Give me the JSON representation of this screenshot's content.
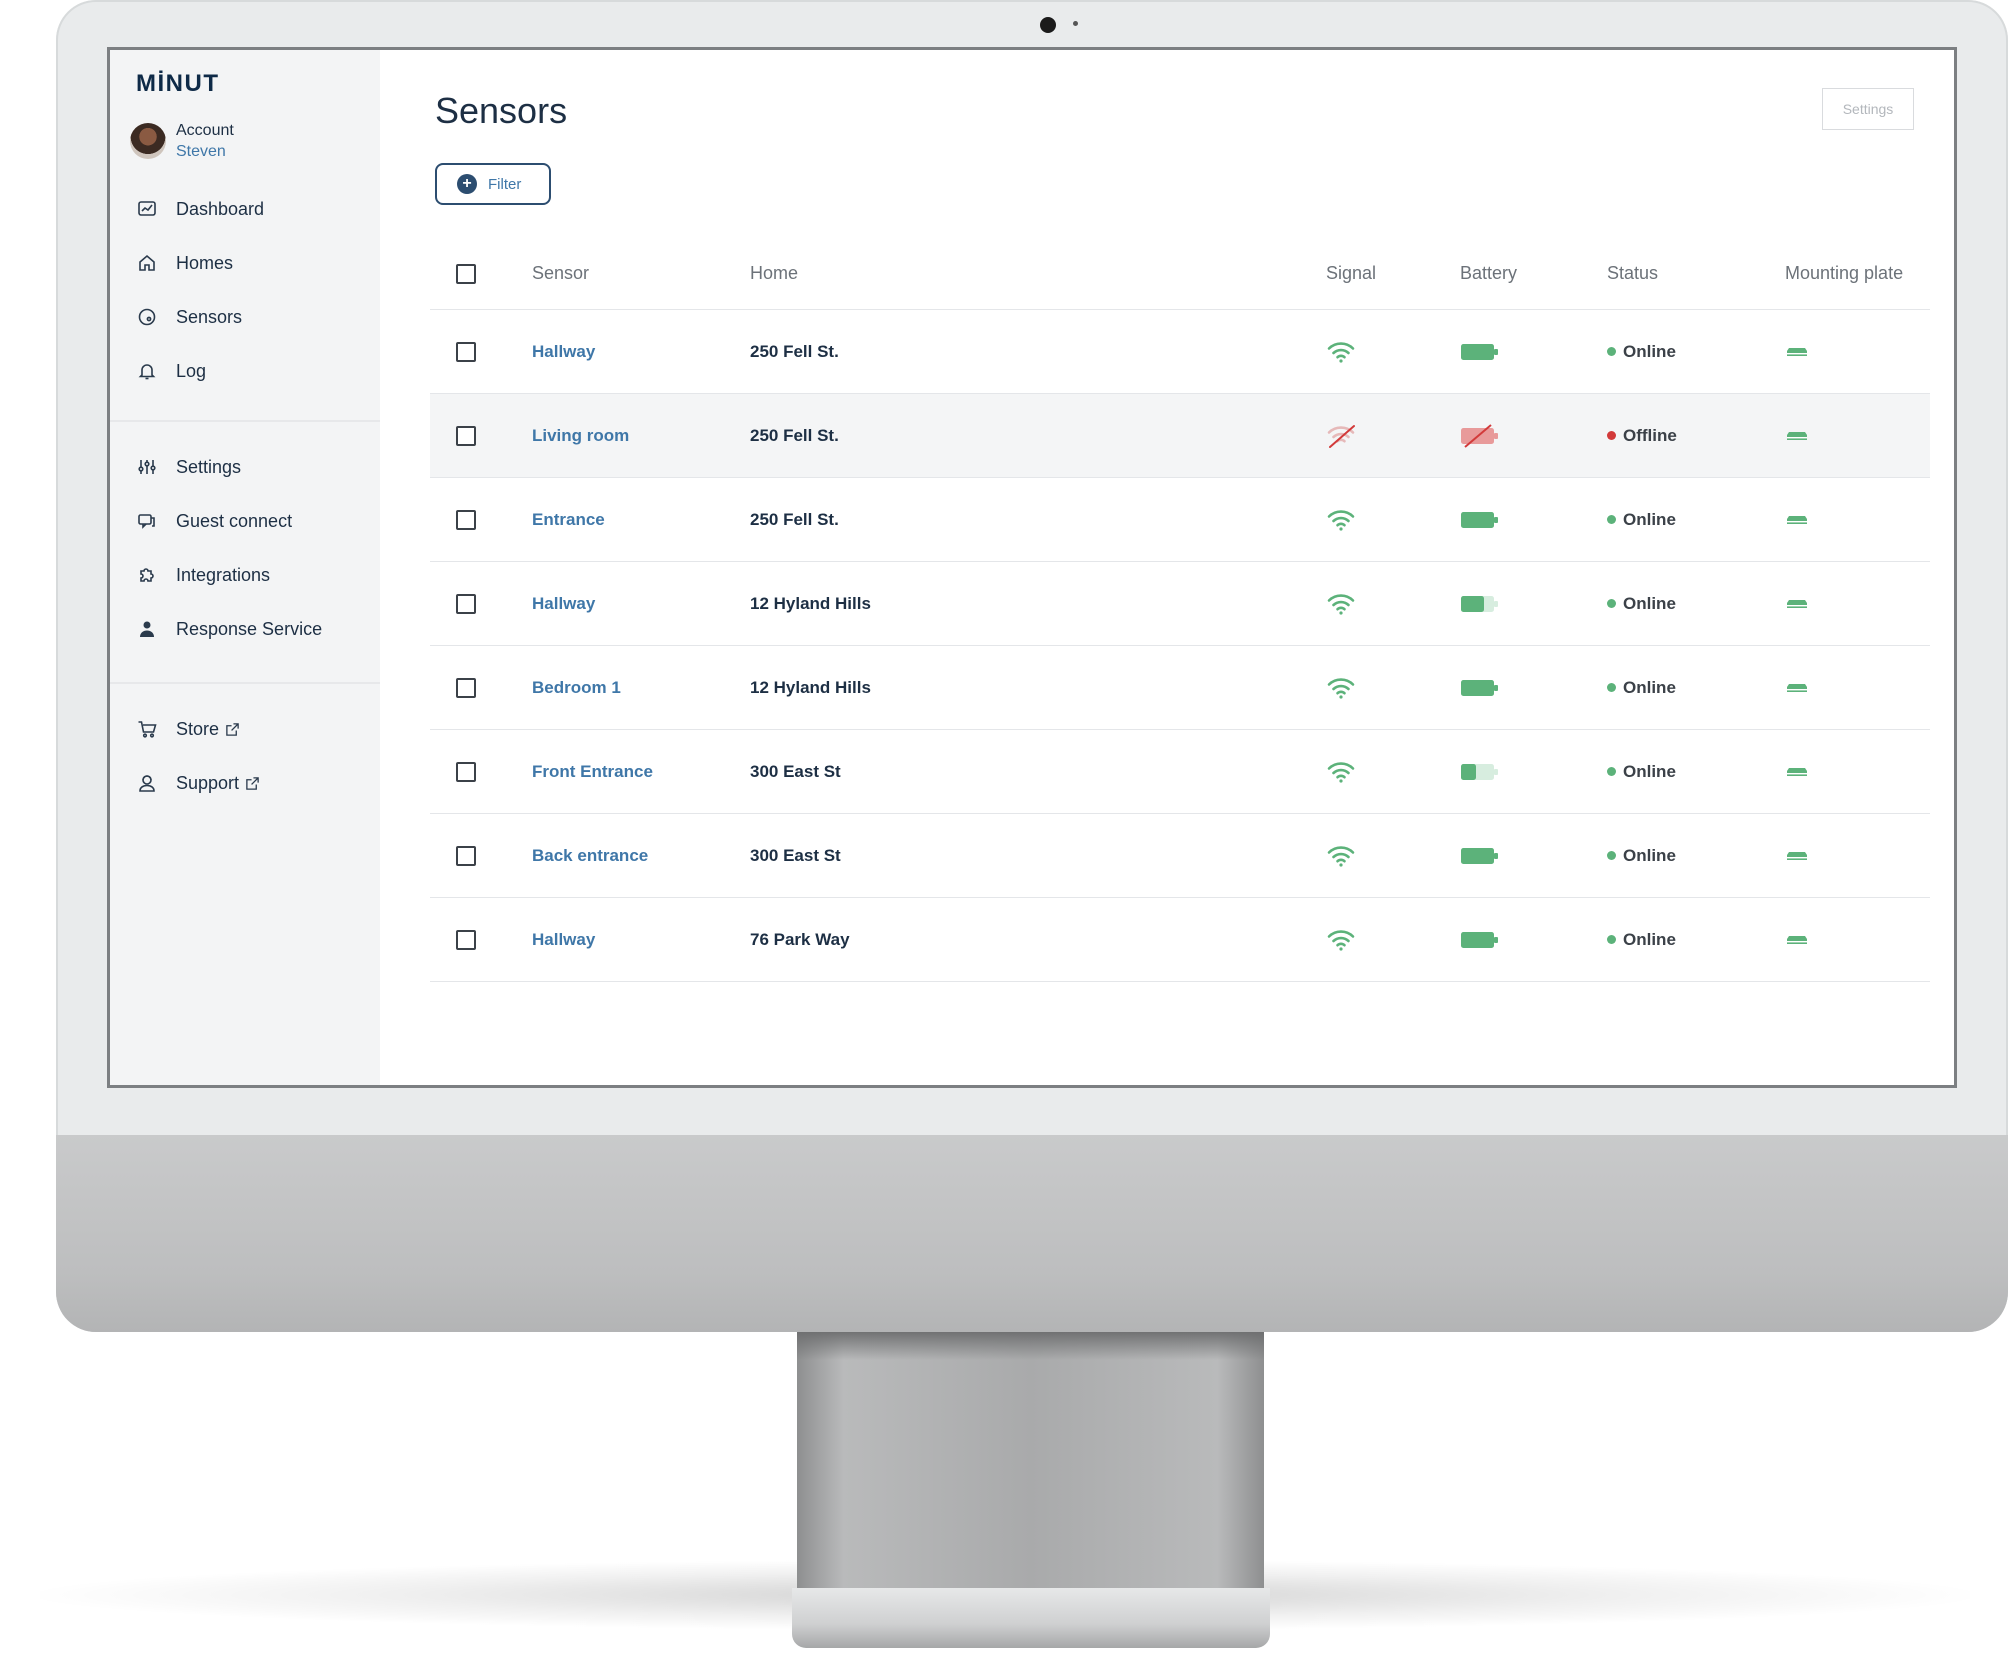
{
  "app": {
    "logo": "MİNUT"
  },
  "account": {
    "label": "Account",
    "user": "Steven"
  },
  "nav": {
    "primary": [
      {
        "id": "dashboard",
        "label": "Dashboard",
        "icon": "dashboard-icon"
      },
      {
        "id": "homes",
        "label": "Homes",
        "icon": "home-icon"
      },
      {
        "id": "sensors",
        "label": "Sensors",
        "icon": "sensor-icon"
      },
      {
        "id": "log",
        "label": "Log",
        "icon": "bell-icon"
      }
    ],
    "secondary": [
      {
        "id": "settings",
        "label": "Settings",
        "icon": "sliders-icon"
      },
      {
        "id": "guest-connect",
        "label": "Guest connect",
        "icon": "chat-icon"
      },
      {
        "id": "integrations",
        "label": "Integrations",
        "icon": "puzzle-icon"
      },
      {
        "id": "response-service",
        "label": "Response Service",
        "icon": "guard-icon"
      }
    ],
    "external": [
      {
        "id": "store",
        "label": "Store",
        "icon": "cart-icon"
      },
      {
        "id": "support",
        "label": "Support",
        "icon": "support-icon"
      }
    ]
  },
  "page": {
    "title": "Sensors",
    "settings_label": "Settings",
    "filter_label": "Filter"
  },
  "table": {
    "headers": {
      "sensor": "Sensor",
      "home": "Home",
      "signal": "Signal",
      "battery": "Battery",
      "status": "Status",
      "plate": "Mounting plate"
    },
    "rows": [
      {
        "sensor": "Hallway",
        "home": "250 Fell St.",
        "signal": "good",
        "battery": 1.0,
        "status": "Online",
        "plate": "attached"
      },
      {
        "sensor": "Living room",
        "home": "250 Fell St.",
        "signal": "none",
        "battery": "none",
        "status": "Offline",
        "plate": "attached"
      },
      {
        "sensor": "Entrance",
        "home": "250 Fell St.",
        "signal": "good",
        "battery": 1.0,
        "status": "Online",
        "plate": "attached"
      },
      {
        "sensor": "Hallway",
        "home": "12 Hyland Hills",
        "signal": "good",
        "battery": 0.7,
        "status": "Online",
        "plate": "attached"
      },
      {
        "sensor": "Bedroom 1",
        "home": "12 Hyland Hills",
        "signal": "good",
        "battery": 1.0,
        "status": "Online",
        "plate": "attached"
      },
      {
        "sensor": "Front Entrance",
        "home": "300 East St",
        "signal": "good",
        "battery": 0.45,
        "status": "Online",
        "plate": "attached"
      },
      {
        "sensor": "Back entrance",
        "home": "300 East St",
        "signal": "good",
        "battery": 1.0,
        "status": "Online",
        "plate": "attached"
      },
      {
        "sensor": "Hallway",
        "home": "76 Park Way",
        "signal": "good",
        "battery": 1.0,
        "status": "Online",
        "plate": "attached"
      }
    ]
  },
  "colors": {
    "online": "#5cb27a",
    "offline": "#d23a3a",
    "offline_fill": "#e89a9a",
    "link": "#3f77a8",
    "text": "#1d2f44"
  }
}
